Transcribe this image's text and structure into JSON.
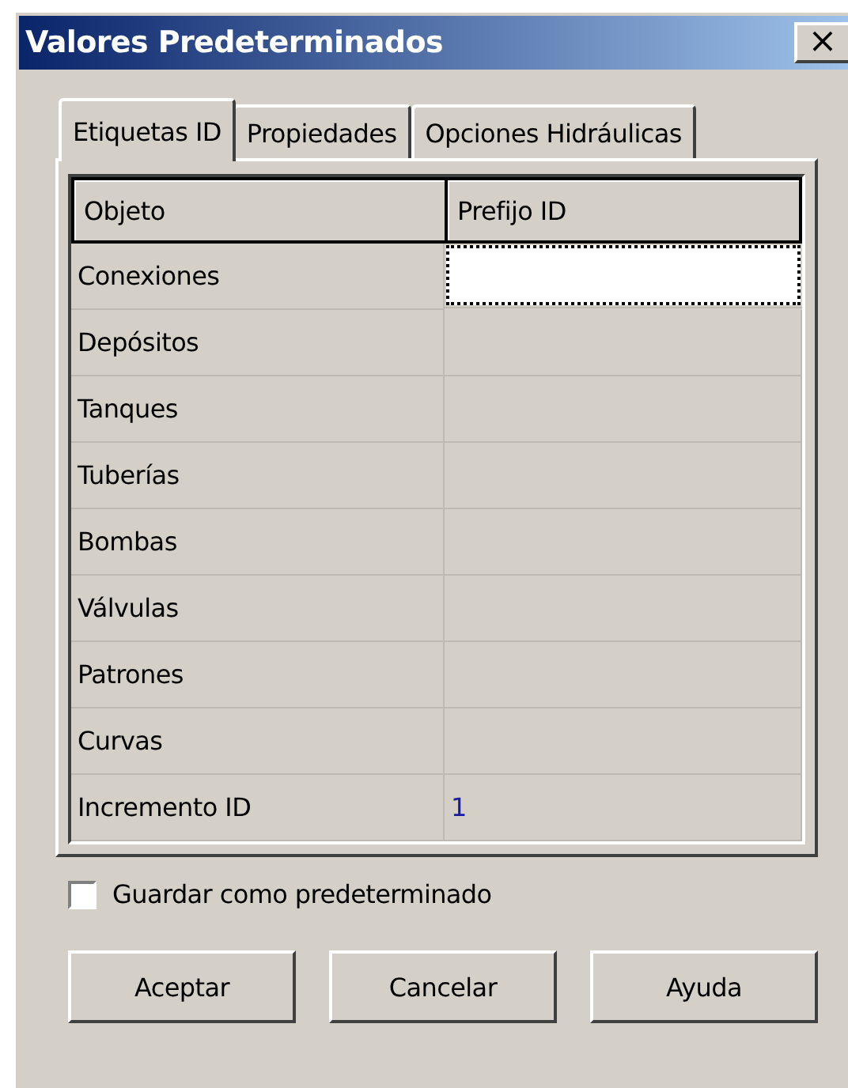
{
  "window": {
    "title": "Valores Predeterminados",
    "close": "×"
  },
  "tabs": [
    {
      "label": "Etiquetas ID",
      "selected": true
    },
    {
      "label": "Propiedades",
      "selected": false
    },
    {
      "label": "Opciones Hidráulicas",
      "selected": false
    }
  ],
  "table": {
    "columns": [
      "Objeto",
      "Prefijo ID"
    ],
    "rows": [
      {
        "object": "Conexiones",
        "selected": true
      },
      {
        "object": "Depósitos",
        "selected": false
      },
      {
        "object": "Tanques",
        "selected": false
      },
      {
        "object": "Tuberías",
        "selected": false
      },
      {
        "object": "Bombas",
        "selected": false
      },
      {
        "object": "Válvulas",
        "selected": false
      },
      {
        "object": "Patrones",
        "selected": false
      },
      {
        "object": "Curvas",
        "selected": false
      },
      {
        "object": "Incremento ID",
        "value": "1",
        "selected": false
      }
    ]
  },
  "checkbox": {
    "label": "Guardar como predeterminado",
    "checked": false
  },
  "buttons": [
    "Aceptar",
    "Cancelar",
    "Ayuda"
  ]
}
